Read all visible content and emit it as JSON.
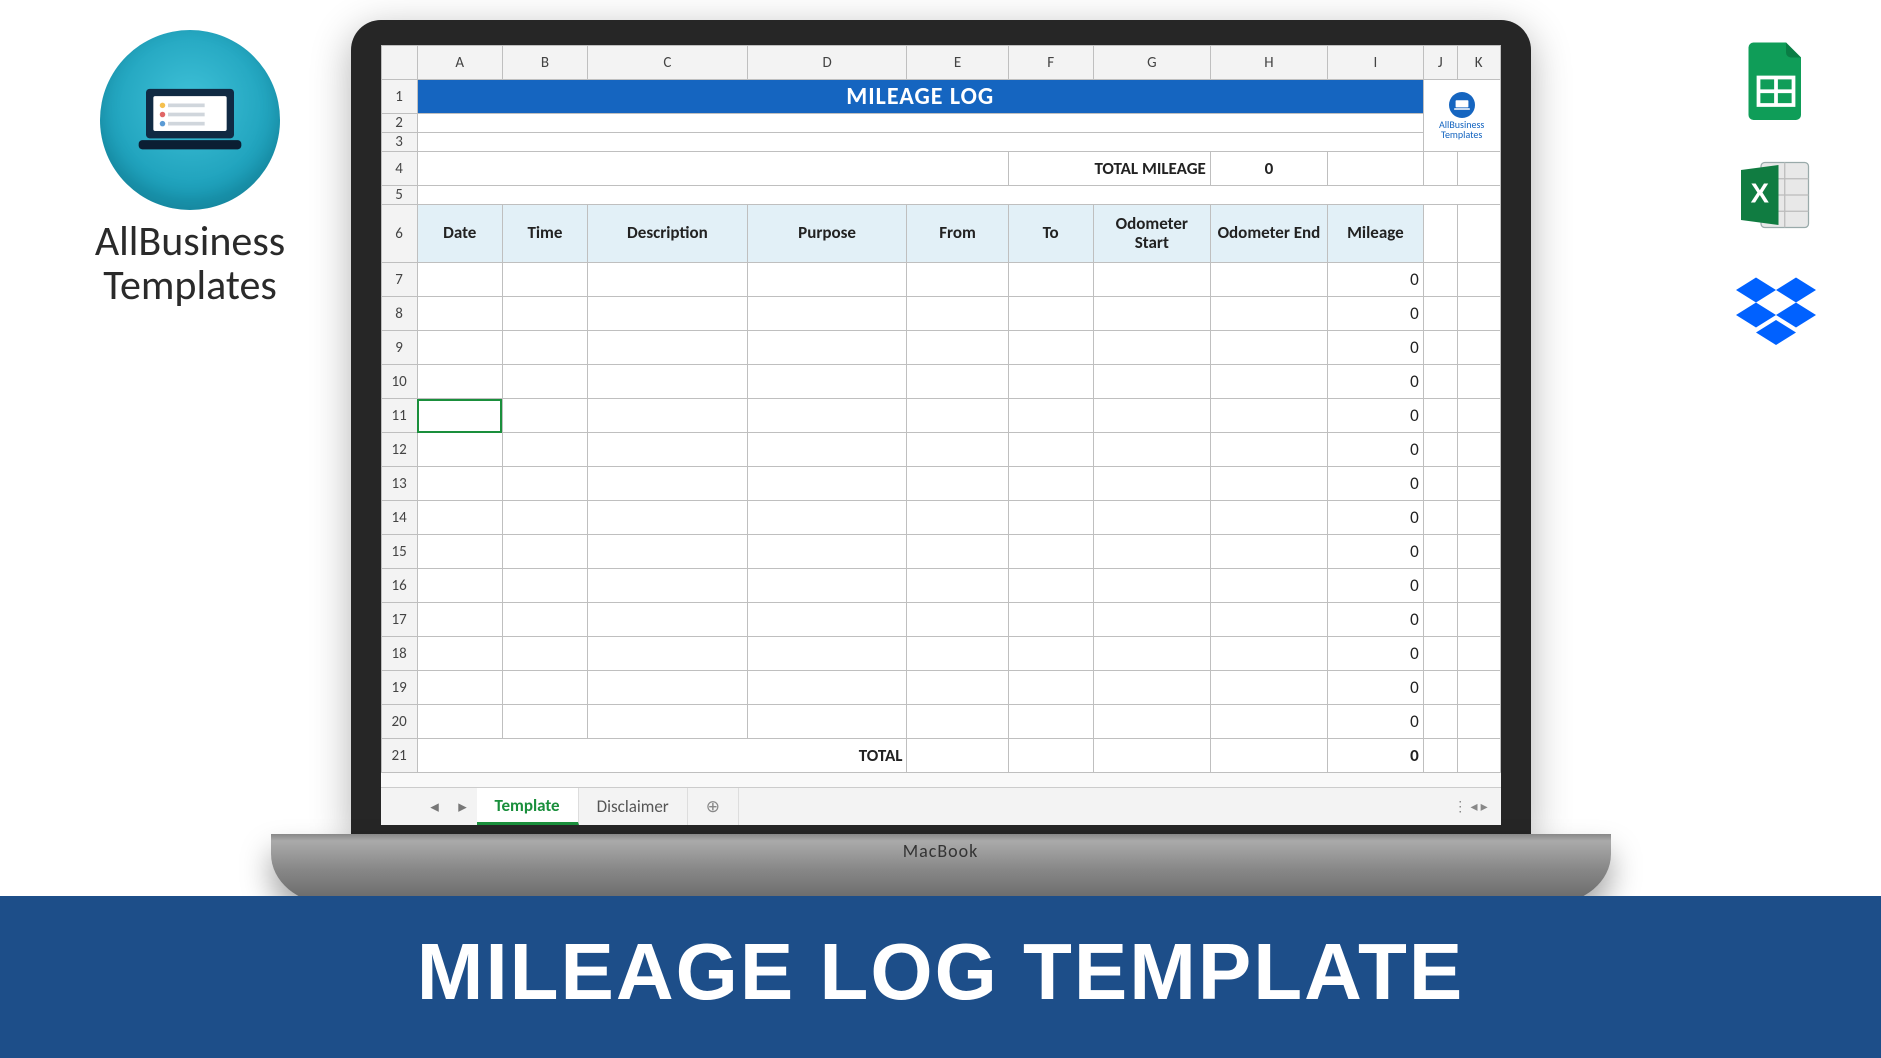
{
  "brand": {
    "line1": "AllBusiness",
    "line2": "Templates"
  },
  "side_icons": {
    "sheets": "google-sheets-icon",
    "excel": "excel-icon",
    "dropbox": "dropbox-icon"
  },
  "laptop_label": "MacBook",
  "footer_title": "MILEAGE LOG TEMPLATE",
  "spreadsheet": {
    "columns": [
      "A",
      "B",
      "C",
      "D",
      "E",
      "F",
      "G",
      "H",
      "I",
      "J",
      "K"
    ],
    "banner": "MILEAGE LOG",
    "total_mileage_label": "TOTAL MILEAGE",
    "total_mileage_value": "0",
    "headers": [
      "Date",
      "Time",
      "Description",
      "Purpose",
      "From",
      "To",
      "Odometer Start",
      "Odometer End",
      "Mileage"
    ],
    "data_row_numbers": [
      7,
      8,
      9,
      10,
      11,
      12,
      13,
      14,
      15,
      16,
      17,
      18,
      19,
      20
    ],
    "default_mileage": "0",
    "total_row": {
      "number": 21,
      "label": "TOTAL",
      "value": "0"
    },
    "selected_cell": {
      "row": 11,
      "col": "A"
    },
    "tabs": {
      "active": "Template",
      "others": [
        "Disclaimer"
      ],
      "add": "⊕"
    },
    "logo_text": "AllBusiness Templates"
  }
}
